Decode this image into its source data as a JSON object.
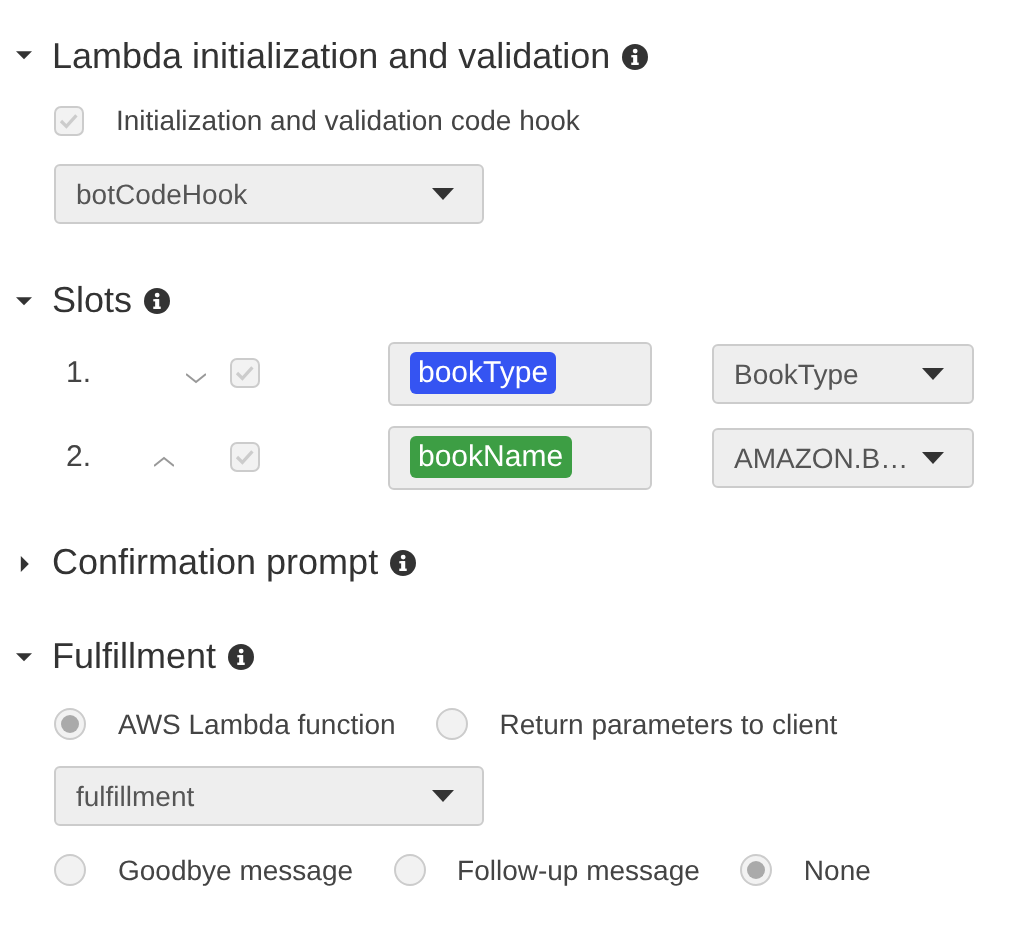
{
  "sections": [
    {
      "kind": "lambda",
      "title": "Lambda initialization and validation",
      "expanded": true,
      "code_hook": {
        "label": "Initialization and validation code hook",
        "checked": true
      },
      "function_select": {
        "value": "botCodeHook"
      }
    },
    {
      "kind": "slots",
      "title": "Slots",
      "expanded": true,
      "slots": [
        {
          "number": "1.",
          "kind": "down",
          "required": true,
          "name": "bookType",
          "color": "#3554f2",
          "type": "BookType"
        },
        {
          "number": "2.",
          "kind": "up",
          "required": true,
          "name": "bookName",
          "color": "#3d9e44",
          "type": "AMAZON.B…"
        }
      ]
    },
    {
      "kind": "confirmation",
      "title": "Confirmation prompt",
      "expanded": false
    },
    {
      "kind": "fulfillment",
      "title": "Fulfillment",
      "expanded": true,
      "modes": [
        {
          "label": "AWS Lambda function",
          "selected": true
        },
        {
          "label": "Return parameters to client",
          "selected": false
        }
      ],
      "function_select": {
        "value": "fulfillment"
      },
      "follow_up": [
        {
          "label": "Goodbye message",
          "selected": false
        },
        {
          "label": "Follow-up message",
          "selected": false
        },
        {
          "label": "None",
          "selected": true
        }
      ]
    }
  ]
}
